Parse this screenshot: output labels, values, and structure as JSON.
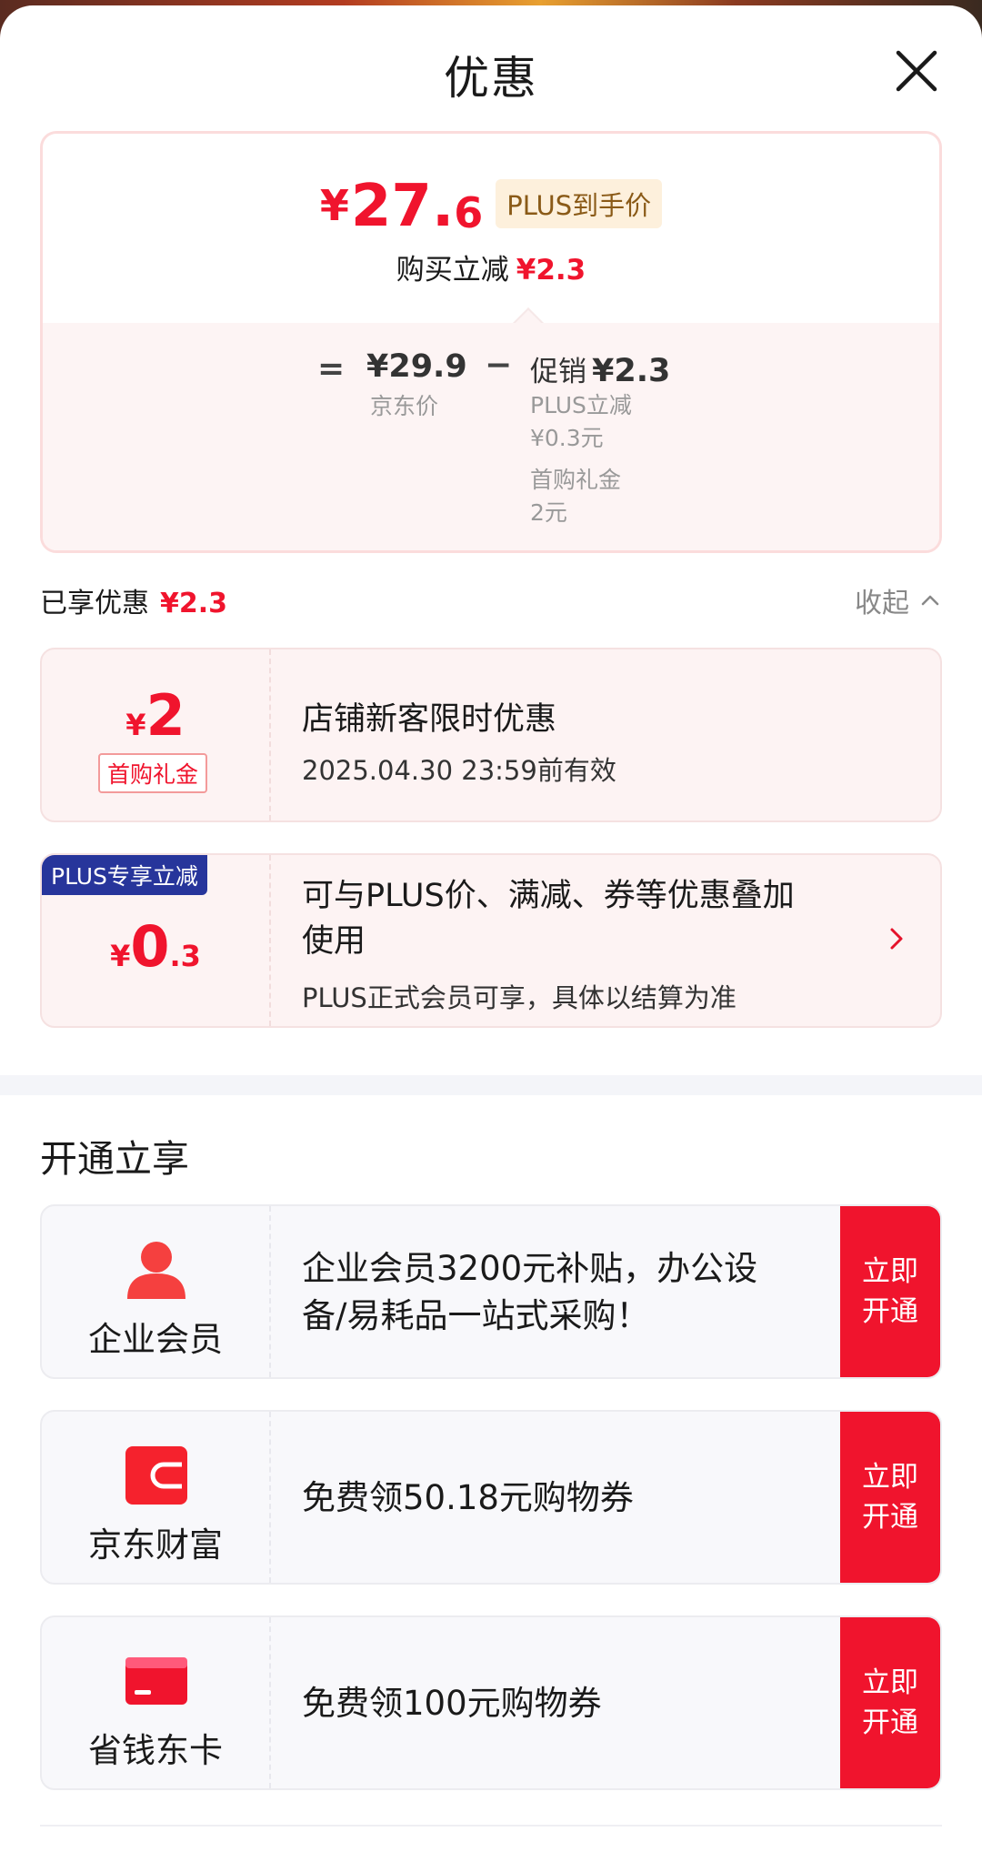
{
  "sheet": {
    "title": "优惠",
    "close_icon": "close-icon"
  },
  "price_summary": {
    "currency": "¥",
    "final_price_int": "27.",
    "final_price_dec": "6",
    "plus_tag": "PLUS到手价",
    "buy_reduce_label": "购买立减",
    "buy_reduce_amount": "¥2.3",
    "equals": "=",
    "jd_price": "¥29.9",
    "jd_price_label": "京东价",
    "minus": "−",
    "promo_label": "促销",
    "promo_amount": "¥2.3",
    "plus_reduce_label": "PLUS立减",
    "plus_reduce_value": "¥0.3元",
    "first_gift_label": "首购礼金",
    "first_gift_value": "2元"
  },
  "enjoyed": {
    "label": "已享优惠",
    "amount": "¥2.3",
    "collapse_label": "收起"
  },
  "coupons": [
    {
      "currency": "¥",
      "amount_int": "2",
      "amount_dec": "",
      "tag": "首购礼金",
      "title": "店铺新客限时优惠",
      "subtitle": "2025.04.30 23:59前有效"
    },
    {
      "badge": "PLUS专享立减",
      "currency": "¥",
      "amount_int": "0",
      "amount_dec": ".3",
      "title_line1": "可与PLUS价、满减、券等优惠叠加",
      "title_line2": "使用",
      "subtitle": "PLUS正式会员可享，具体以结算为准"
    }
  ],
  "open_section": {
    "title": "开通立享",
    "offers": [
      {
        "icon": "person-icon",
        "name": "企业会员",
        "desc_line1": "企业会员3200元补贴，办公设",
        "desc_line2": "备/易耗品一站式采购！",
        "btn_line1": "立即",
        "btn_line2": "开通"
      },
      {
        "icon": "wallet-icon",
        "name": "京东财富",
        "desc_line1": "免费领50.18元购物券",
        "desc_line2": "",
        "btn_line1": "立即",
        "btn_line2": "开通"
      },
      {
        "icon": "card-icon",
        "name": "省钱东卡",
        "desc_line1": "免费领100元购物券",
        "desc_line2": "",
        "btn_line1": "立即",
        "btn_line2": "开通"
      }
    ]
  },
  "colors": {
    "accent_red": "#f0142d",
    "plus_blue": "#27359b",
    "tag_bg": "#fdf0dc"
  }
}
